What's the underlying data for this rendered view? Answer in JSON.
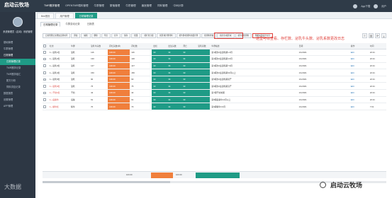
{
  "app": {
    "logo": "启动云牧场"
  },
  "topnav": [
    "TMR搅拌管理",
    "OPENTMR喂料管理",
    "牛群管理",
    "繁殖管理",
    "牛奶管理",
    "兽医管理",
    "饲料管理",
    "中间计算"
  ],
  "topright": {
    "app_label": "App下载",
    "user": "用户"
  },
  "sidebar": {
    "user_name": "系统管理员（启动）系统管理",
    "items": [
      {
        "label": "基础管理",
        "indent": false,
        "state": "normal"
      },
      {
        "label": "牛群管理",
        "indent": false,
        "state": "normal"
      },
      {
        "label": "日常管理",
        "indent": false,
        "state": "hi"
      },
      {
        "label": "日常管理记录",
        "indent": true,
        "state": "active"
      },
      {
        "label": "TMR搅拌记录",
        "indent": true,
        "state": "normal"
      },
      {
        "label": "TMR搅拌组汇",
        "indent": true,
        "state": "normal"
      },
      {
        "label": "配方分析",
        "indent": true,
        "state": "normal"
      },
      {
        "label": "饲料供应记录",
        "indent": true,
        "state": "normal"
      },
      {
        "label": "数据报表",
        "indent": false,
        "state": "normal"
      },
      {
        "label": "设置管理",
        "indent": false,
        "state": "normal"
      },
      {
        "label": "APP管理",
        "indent": false,
        "state": "normal"
      }
    ]
  },
  "tabs": [
    {
      "label": "Bee首页",
      "active": false
    },
    {
      "label": "用户管理",
      "active": false
    },
    {
      "label": "日常管理记录",
      "active": true
    }
  ],
  "subtabs": [
    {
      "label": "日常管理记录",
      "active": true
    },
    {
      "label": "牛群变动记录",
      "active": false
    },
    {
      "label": "日报表",
      "active": false
    }
  ],
  "toolbar": [
    "日常管理记录增加日期时间",
    "添加",
    "编辑",
    "删除",
    "导出",
    "打印",
    "保存",
    "批量",
    "按栏位分组",
    "按区域计算饲料",
    "按牛群/按饲料用量计算",
    "按饲料查看",
    "按栏位/按区域",
    "按牛群按饲料",
    "数据来源设计信息"
  ],
  "annotation": "这里可以查看、存栏数、泌乳牛头数、泌乳系数更改日志",
  "right_tools": [
    "≡",
    "▥",
    "⟳",
    "⤓"
  ],
  "table": {
    "headers": [
      "",
      "栏舍",
      "牛群",
      "泌乳牛头数",
      "存栏头数(单)",
      "存栏数",
      "出栏",
      "出生头数",
      "死亡",
      "泌乳系数",
      "牛群描述",
      "",
      "日期",
      "操作",
      "时间"
    ],
    "rows": [
      {
        "pen": "1---泌乳1栏",
        "group": "泌乳",
        "a": "116",
        "b": "100.00",
        "c": "116",
        "d": "33",
        "e": "34",
        "f": "33",
        "note": "第1期次2班泌乳期1-3月",
        "sub": "",
        "date": "1/1/2021",
        "op": "Edit",
        "time": "22:21",
        "red": false
      },
      {
        "pen": "1---泌乳2栏",
        "group": "泌乳",
        "a": "130",
        "b": "100.00",
        "c": "130",
        "d": "33",
        "e": "34",
        "f": "34",
        "note": "第2期次2班泌乳期4-6月",
        "sub": "",
        "date": "1/1/2021",
        "op": "Edit",
        "time": "22:21",
        "red": false
      },
      {
        "pen": "1---泌乳3栏",
        "group": "泌乳",
        "a": "147",
        "b": "100.00",
        "c": "147",
        "d": "33",
        "e": "34",
        "f": "33",
        "note": "第3期次2班泌乳期7-9月",
        "sub": "",
        "date": "1/1/2021",
        "op": "Edit",
        "time": "22:21",
        "red": false
      },
      {
        "pen": "1---泌乳4栏",
        "group": "泌乳",
        "a": "150",
        "b": "100.00",
        "c": "150",
        "d": "33",
        "e": "34",
        "f": "33",
        "note": "第4期次2班泌乳期10月以上",
        "sub": "",
        "date": "1/1/2021",
        "op": "Edit",
        "time": "22:21",
        "red": false
      },
      {
        "pen": "1---泌乳5栏",
        "group": "泌乳",
        "a": "90",
        "b": "100.00",
        "c": "90",
        "d": "33",
        "e": "34",
        "f": "33",
        "note": "第5期次2班泌乳期初产",
        "sub": "",
        "date": "1/1/2021",
        "op": "Edit",
        "time": "22:21",
        "red": false
      },
      {
        "pen": "1---泌乳6栏",
        "group": "泌乳",
        "a": "75",
        "b": "100.00",
        "c": "75",
        "d": "33",
        "e": "34",
        "f": "33",
        "note": "第6期次2班泌乳期高产",
        "sub": "",
        "date": "1/1/2021",
        "op": "Edit",
        "time": "22:21",
        "red": true
      },
      {
        "pen": "1---干奶1栏",
        "group": "干奶",
        "a": "42",
        "b": "100.00",
        "c": "42",
        "d": "33",
        "e": "34",
        "f": "33",
        "note": "第7期干奶前期",
        "sub": "",
        "date": "1/1/2021",
        "op": "Edit",
        "time": "22:21",
        "red": true
      },
      {
        "pen": "1---后备牛",
        "group": "后备",
        "a": "61",
        "b": "100.00",
        "c": "61",
        "d": "33",
        "e": "34",
        "f": "33",
        "note": "第8期后备牛12月以上",
        "sub": "",
        "date": "1/1/2021",
        "op": "Edit",
        "time": "22:21",
        "red": true
      },
      {
        "pen": "1---犊牛栏",
        "group": "犊牛",
        "a": "70",
        "b": "100.00",
        "c": "70",
        "d": "33",
        "e": "34",
        "f": "33",
        "note": "第9期犊牛0-6月",
        "sub": "",
        "date": "1/1/2021",
        "op": "Edit",
        "time": "7:01",
        "red": true
      }
    ]
  },
  "footer": {
    "left": "100.00",
    "total": "100.00"
  },
  "watermark": {
    "left": "大数据",
    "right": "启动云牧场"
  },
  "colors": {
    "teal": "#1f9b86",
    "orange": "#f07f3c",
    "dark": "#2f3b48",
    "annotation_red": "#e0413b"
  }
}
